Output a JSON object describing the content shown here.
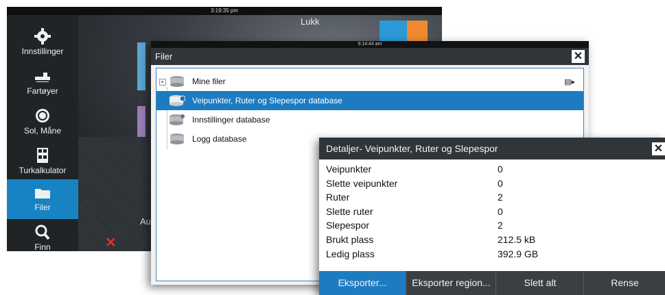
{
  "back_screen": {
    "time": "3:19:35 pm",
    "close_label": "Lukk",
    "partial_label": "Au",
    "sidebar": [
      {
        "label": "Innstillinger",
        "icon": "gear-icon"
      },
      {
        "label": "Fartøyer",
        "icon": "vessel-icon"
      },
      {
        "label": "Sol, Måne",
        "icon": "sun-moon-icon"
      },
      {
        "label": "Turkalkulator",
        "icon": "calculator-icon"
      },
      {
        "label": "Filer",
        "icon": "folder-icon",
        "active": true
      },
      {
        "label": "Finn",
        "icon": "search-icon"
      }
    ]
  },
  "filer": {
    "time": "9:14:44 am",
    "title": "Filer",
    "close_glyph": "✕",
    "rows": [
      {
        "label": "Mine filer"
      },
      {
        "label": "Veipunkter, Ruter og Slepespor database",
        "selected": true
      },
      {
        "label": "Innstillinger database"
      },
      {
        "label": "Logg database"
      }
    ]
  },
  "details": {
    "title": "Detaljer- Veipunkter, Ruter og Slepespor",
    "close_glyph": "✕",
    "rows": [
      {
        "label": "Veipunkter",
        "value": "0"
      },
      {
        "label": "Slette veipunkter",
        "value": "0"
      },
      {
        "label": "Ruter",
        "value": "2"
      },
      {
        "label": "Slette ruter",
        "value": "0"
      },
      {
        "label": "Slepespor",
        "value": "2"
      },
      {
        "label": "Brukt plass",
        "value": "212.5 kB"
      },
      {
        "label": "Ledig plass",
        "value": "392.9 GB"
      }
    ],
    "buttons": [
      {
        "label": "Eksporter...",
        "active": true
      },
      {
        "label": "Eksporter region..."
      },
      {
        "label": "Slett alt"
      },
      {
        "label": "Rense"
      }
    ]
  },
  "colors": {
    "accent": "#1d7cc1",
    "titlebar": "#30353a",
    "warning": "#e02a2a"
  }
}
